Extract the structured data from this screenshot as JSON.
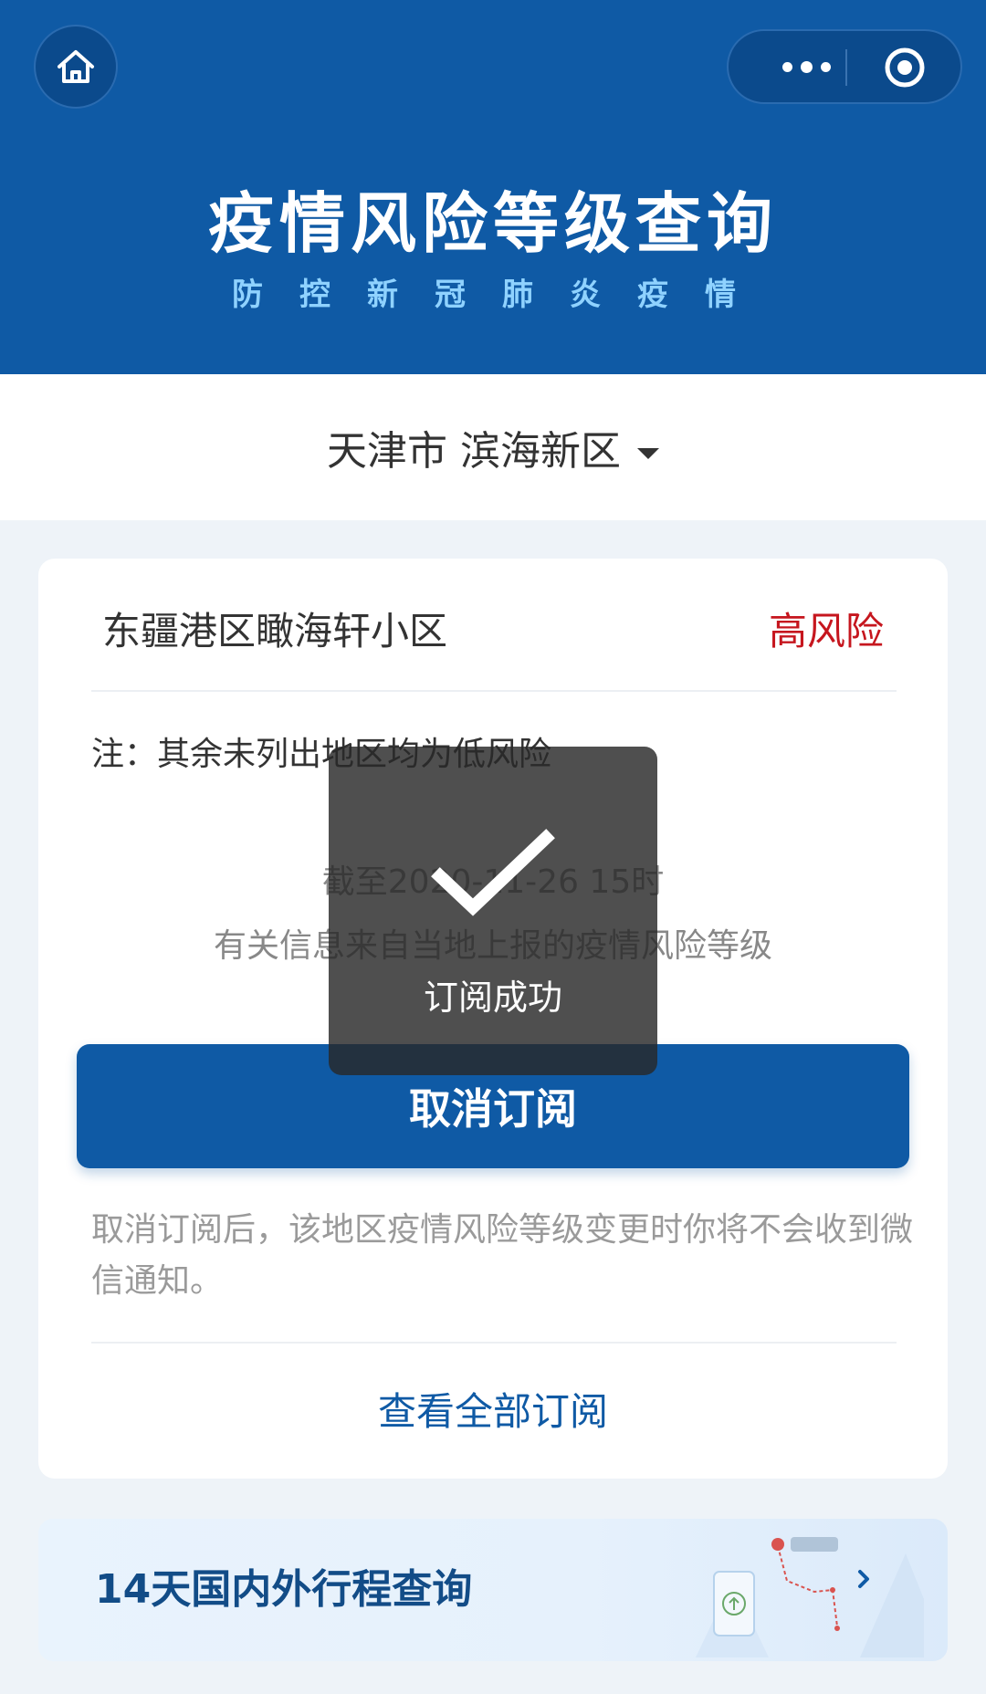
{
  "header": {
    "title": "疫情风险等级查询",
    "subtitle": "防控新冠肺炎疫情",
    "home_icon": "home-icon",
    "more_icon": "more-dots-icon",
    "close_icon": "target-circle-icon"
  },
  "location": {
    "label": "天津市 滨海新区"
  },
  "card": {
    "area_name": "东疆港区瞰海轩小区",
    "risk_level": "高风险",
    "note": "注：其余未列出地区均为低风险",
    "until": "截至2020-11-26 15时",
    "source": "有关信息来自当地上报的疫情风险等级",
    "unsubscribe_button": "取消订阅",
    "description": "取消订阅后，该地区疫情风险等级变更时你将不会收到微信通知。",
    "view_all": "查看全部订阅"
  },
  "trip": {
    "title": "14天国内外行程查询",
    "arrow_icon": "chevron-right-icon"
  },
  "toast": {
    "text": "订阅成功",
    "icon": "checkmark-icon"
  },
  "colors": {
    "primary": "#0f5aa5",
    "risk": "#c6161e",
    "background": "#eef3f8"
  }
}
